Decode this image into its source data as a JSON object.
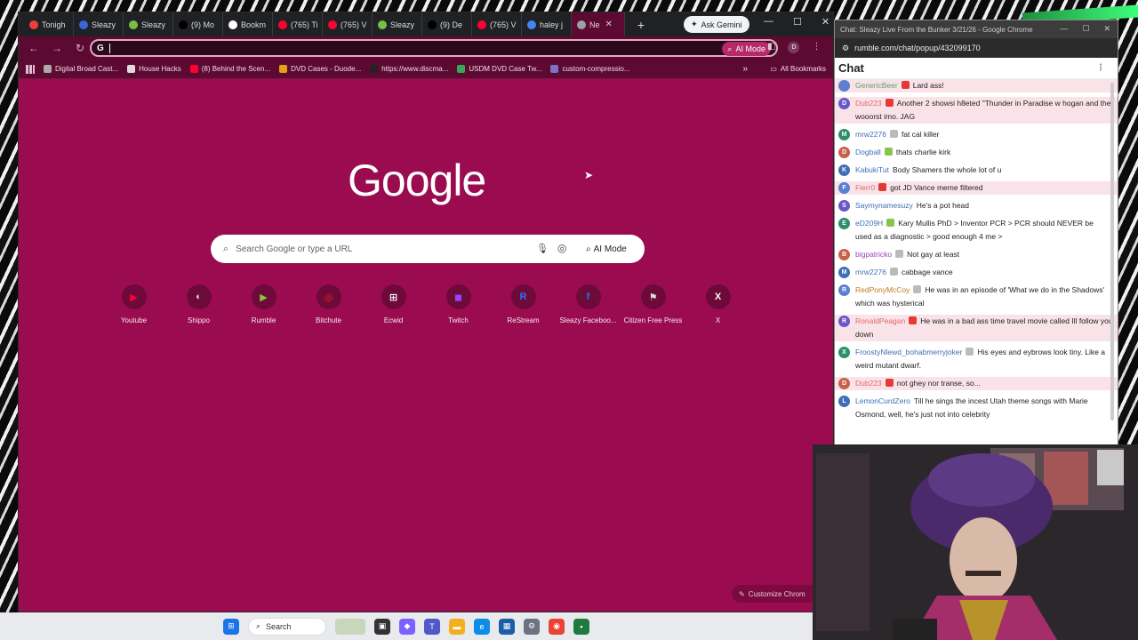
{
  "browser": {
    "tabs": [
      {
        "label": "Tonigh",
        "color": "#ea4335"
      },
      {
        "label": "Sleazy",
        "color": "#3b64d6"
      },
      {
        "label": "Sleazy",
        "color": "#75c043"
      },
      {
        "label": "(9) Mo",
        "color": "#000000"
      },
      {
        "label": "Bookm",
        "color": "#ffffff"
      },
      {
        "label": "(765) Ti",
        "color": "#ff0033"
      },
      {
        "label": "(765) V",
        "color": "#ff0033"
      },
      {
        "label": "Sleazy",
        "color": "#75c043"
      },
      {
        "label": "(9) De",
        "color": "#000000"
      },
      {
        "label": "(765) V",
        "color": "#ff0033"
      },
      {
        "label": "haley j",
        "color": "#4285f4"
      },
      {
        "label": "Ne",
        "color": "#9aa0a6"
      }
    ],
    "tab_close": "✕",
    "new_tab": "+",
    "ask_gemini": "Ask Gemini",
    "omnibox_value": "",
    "omnibox_g": "G",
    "ai_mode_pill": "AI Mode",
    "bookmarks": [
      {
        "label": "Digital Broad Cast...",
        "color": "#aaaaaa"
      },
      {
        "label": "House Hacks",
        "color": "#dddddd"
      },
      {
        "label": "(8) Behind the Scen...",
        "color": "#ff0033"
      },
      {
        "label": "DVD Cases - Duode...",
        "color": "#e5a11a"
      },
      {
        "label": "https://www.discma...",
        "color": "#222222"
      },
      {
        "label": "USDM DVD Case Tw...",
        "color": "#3aa757"
      },
      {
        "label": "custom-compressio...",
        "color": "#7a73c8"
      }
    ],
    "bookmarks_more": "»",
    "all_bookmarks": "All Bookmarks",
    "accent": "#9a0c4f"
  },
  "newtab": {
    "logo": "Google",
    "search_placeholder": "Search Google or type a URL",
    "ai_mode_label": "AI Mode",
    "shortcuts": [
      {
        "label": "Youtube",
        "glyph": "▶",
        "color": "#ff0033"
      },
      {
        "label": "Shippo",
        "glyph": "◐",
        "color": "#dddddd"
      },
      {
        "label": "Rumble",
        "glyph": "▶",
        "color": "#85c742"
      },
      {
        "label": "Bitchute",
        "glyph": "◎",
        "color": "#ee2211"
      },
      {
        "label": "Ecwid",
        "glyph": "⊞",
        "color": "#ffffff"
      },
      {
        "label": "Twitch",
        "glyph": "◼",
        "color": "#9146ff"
      },
      {
        "label": "ReStream",
        "glyph": "R",
        "color": "#2f6bff"
      },
      {
        "label": "Sleazy Faceboo...",
        "glyph": "f",
        "color": "#1877f2"
      },
      {
        "label": "Citizen Free Press",
        "glyph": "⚑",
        "color": "#dddddd"
      },
      {
        "label": "X",
        "glyph": "X",
        "color": "#ffffff"
      }
    ],
    "customize_label": "Customize Chrom"
  },
  "chat_window": {
    "title": "Chat: Sleazy Live From the Bunker 3/21/26 - Google Chrome",
    "url": "rumble.com/chat/popup/432099170",
    "header": "Chat",
    "messages": [
      {
        "user": "GenericBeer",
        "text": "Lard ass!",
        "user_color": "#5aa36a",
        "badge": "#e53935",
        "avatar": "",
        "highlight": true
      },
      {
        "user": "Dub223",
        "text": "Another 2 showsi h8eted \"Thunder in Paradise w hogan and the wooorst imo. JAG",
        "user_color": "#e06a6a",
        "badge": "#e53935",
        "avatar": "D",
        "highlight": true
      },
      {
        "user": "mrw2276",
        "text": "fat cal killer",
        "user_color": "#3f6fb5",
        "badge": "#bbbbbb",
        "avatar": "M",
        "highlight": false
      },
      {
        "user": "Dogball",
        "text": "thats charlie kirk",
        "user_color": "#3f6fb5",
        "badge": "#86c54b",
        "avatar": "D",
        "highlight": false
      },
      {
        "user": "KabukiTut",
        "text": "Body Shamers the whole lot of u",
        "user_color": "#3f6fb5",
        "badge": "",
        "avatar": "K",
        "highlight": false
      },
      {
        "user": "Fierr0",
        "text": "got JD Vance meme filtered",
        "user_color": "#e06a6a",
        "badge": "#e53935",
        "avatar": "F",
        "highlight": true
      },
      {
        "user": "Saymynamesuzy",
        "text": "He's a pot head",
        "user_color": "#3f6fb5",
        "badge": "",
        "avatar": "S",
        "highlight": false
      },
      {
        "user": "eD209H",
        "text": "Kary Mullis PhD > Inventor PCR > PCR should NEVER be used as a diagnostic > good enough 4 me >",
        "user_color": "#3f6fb5",
        "badge": "#86c54b",
        "avatar": "E",
        "highlight": false
      },
      {
        "user": "bigpatricko",
        "text": "Not gay at least",
        "user_color": "#9c3fb5",
        "badge": "#bbbbbb",
        "avatar": "B",
        "highlight": false
      },
      {
        "user": "mrw2276",
        "text": "cabbage vance",
        "user_color": "#3f6fb5",
        "badge": "#bbbbbb",
        "avatar": "M",
        "highlight": false
      },
      {
        "user": "RedPonyMcCoy",
        "text": "He was in an episode of 'What we do in the Shadows' which was hysterical",
        "user_color": "#c07a1e",
        "badge": "#bbbbbb",
        "avatar": "R",
        "highlight": false
      },
      {
        "user": "RonaldPeagan",
        "text": "He was in a bad ass time travel movie called Ill follow you down",
        "user_color": "#e06a6a",
        "badge": "#e53935",
        "avatar": "R",
        "highlight": true
      },
      {
        "user": "FroostyNlewd_bohabmerryjoker",
        "text": "His eyes and eybrows look tiny. Like a weird mutant dwarf.",
        "user_color": "#3f6fb5",
        "badge": "#bbbbbb",
        "avatar": "X",
        "highlight": false
      },
      {
        "user": "Dub223",
        "text": "not ghey nor transe, so...",
        "user_color": "#e06a6a",
        "badge": "#e53935",
        "avatar": "D",
        "highlight": true
      },
      {
        "user": "LemonCurdZero",
        "text": "Till he sings the incest Utah theme songs with Marie Osmond, well, he's just not into celebrity",
        "user_color": "#3f6fb5",
        "badge": "",
        "avatar": "L",
        "highlight": false
      }
    ]
  },
  "taskbar": {
    "search_label": "Search",
    "icons": [
      {
        "name": "windows-start-icon",
        "glyph": "⊞",
        "color": "#1a73e8"
      },
      {
        "name": "widgets-icon",
        "glyph": "",
        "color": "#c8d6b9"
      },
      {
        "name": "task-view-icon",
        "glyph": "▣",
        "color": "#333333"
      },
      {
        "name": "copilot-icon",
        "glyph": "◆",
        "color": "#7b61ff"
      },
      {
        "name": "teams-icon",
        "glyph": "T",
        "color": "#5059c9"
      },
      {
        "name": "file-explorer-icon",
        "glyph": "▬",
        "color": "#f2b01e"
      },
      {
        "name": "edge-icon",
        "glyph": "e",
        "color": "#0c8ce9"
      },
      {
        "name": "store-icon",
        "glyph": "▦",
        "color": "#1a5ea8"
      },
      {
        "name": "settings-icon",
        "glyph": "⚙",
        "color": "#6b7280"
      },
      {
        "name": "chrome-icon",
        "glyph": "◉",
        "color": "#ea4335"
      },
      {
        "name": "app-icon",
        "glyph": "▪",
        "color": "#1e7b3e"
      }
    ]
  }
}
